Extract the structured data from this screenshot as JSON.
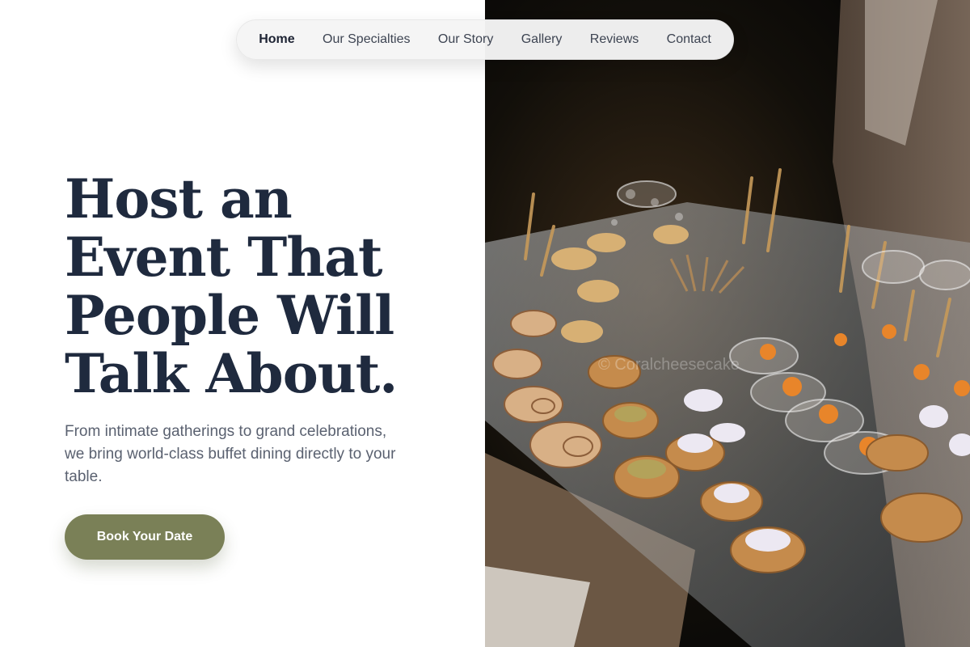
{
  "nav": {
    "items": [
      "Home",
      "Our Specialties",
      "Our Story",
      "Gallery",
      "Reviews",
      "Contact"
    ],
    "active": "Home"
  },
  "hero": {
    "headline_lines": [
      "Host an",
      "Event That",
      "People Will",
      "Talk About."
    ],
    "subtext": "From intimate gatherings to grand celebrations, we bring world-class buffet dining directly to your table.",
    "cta_label": "Book Your Date"
  },
  "photo": {
    "description_icon": "catering-platter-photo",
    "watermark": "© Coralcheesecake"
  },
  "colors": {
    "heading": "#1f2a3e",
    "body_text": "#5a6170",
    "cta": "#7a8057",
    "nav_bg": "#f5f5f5"
  }
}
